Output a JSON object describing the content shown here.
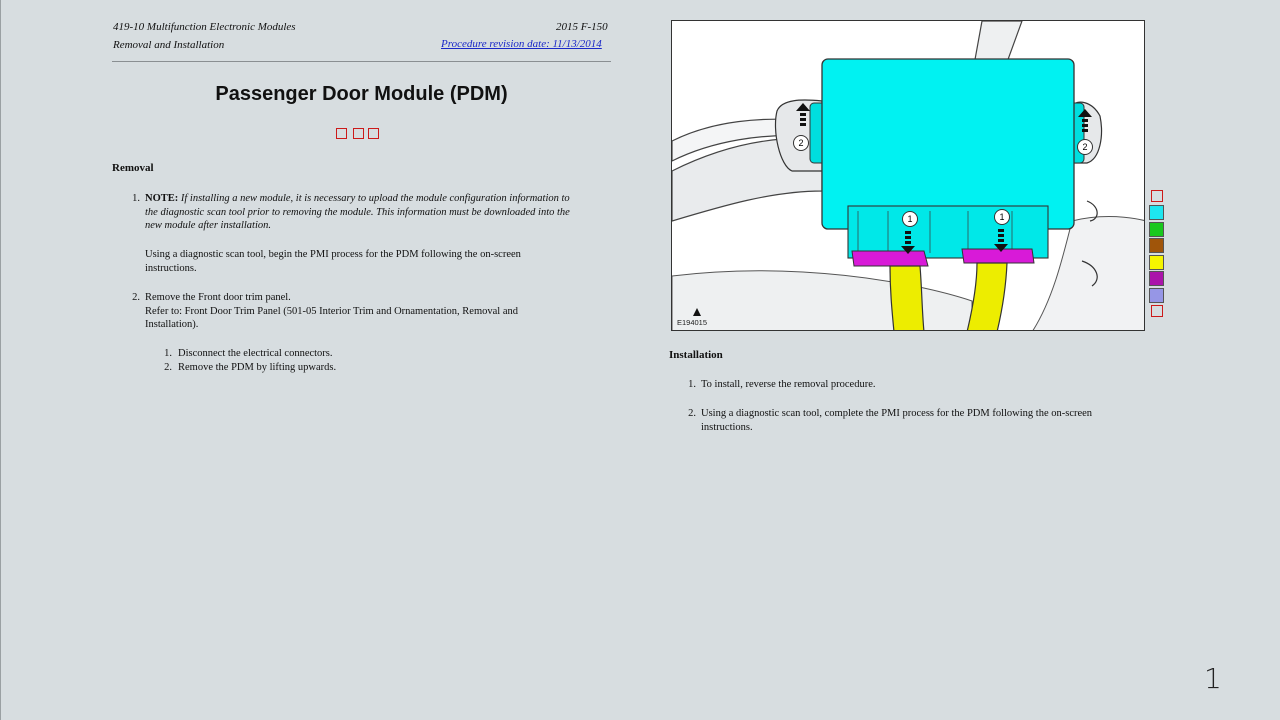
{
  "header": {
    "manual_section": "419-10 Multifunction Electronic Modules",
    "vehicle": "2015 F-150",
    "procedure_type": "Removal and Installation",
    "revision_link": "Procedure revision date: 11/13/2014"
  },
  "title": "Passenger Door Module (PDM)",
  "removal": {
    "heading": "Removal",
    "steps": [
      {
        "num": "1.",
        "note_label": "NOTE:",
        "note_text_lines": [
          "If installing a new module, it is necessary to upload the module configuration information to",
          "the diagnostic scan tool prior to removing the module. This information must be downloaded into the",
          "new module after installation."
        ],
        "text_lines": [
          "Using a diagnostic scan tool, begin the PMI process for the PDM following the on-screen",
          "instructions."
        ]
      },
      {
        "num": "2.",
        "text": "Remove the Front door trim panel.",
        "refer_lines": [
          "Refer to: Front Door Trim Panel (501-05 Interior Trim and Ornamentation, Removal and",
          "Installation)."
        ],
        "substeps": [
          {
            "num": "1.",
            "text": "Disconnect the electrical connectors."
          },
          {
            "num": "2.",
            "text": "Remove the PDM by lifting upwards."
          }
        ]
      }
    ]
  },
  "figure": {
    "label": "E194015",
    "callouts": [
      "1",
      "1",
      "2",
      "2"
    ],
    "colors": {
      "module": "#00f2f2",
      "connector": "#d81ad8",
      "harness": "#eded00",
      "body": "#e8eaec"
    }
  },
  "legend_colors": [
    "#1ee6f0",
    "#19c81e",
    "#a0550a",
    "#f5f500",
    "#aa14aa",
    "#9696e6"
  ],
  "installation": {
    "heading": "Installation",
    "steps": [
      {
        "num": "1.",
        "lines": [
          "To install, reverse the removal procedure."
        ]
      },
      {
        "num": "2.",
        "lines": [
          "Using a diagnostic scan tool, complete the PMI process for the PDM following the on-screen",
          "instructions."
        ]
      }
    ]
  },
  "page_number": "1"
}
